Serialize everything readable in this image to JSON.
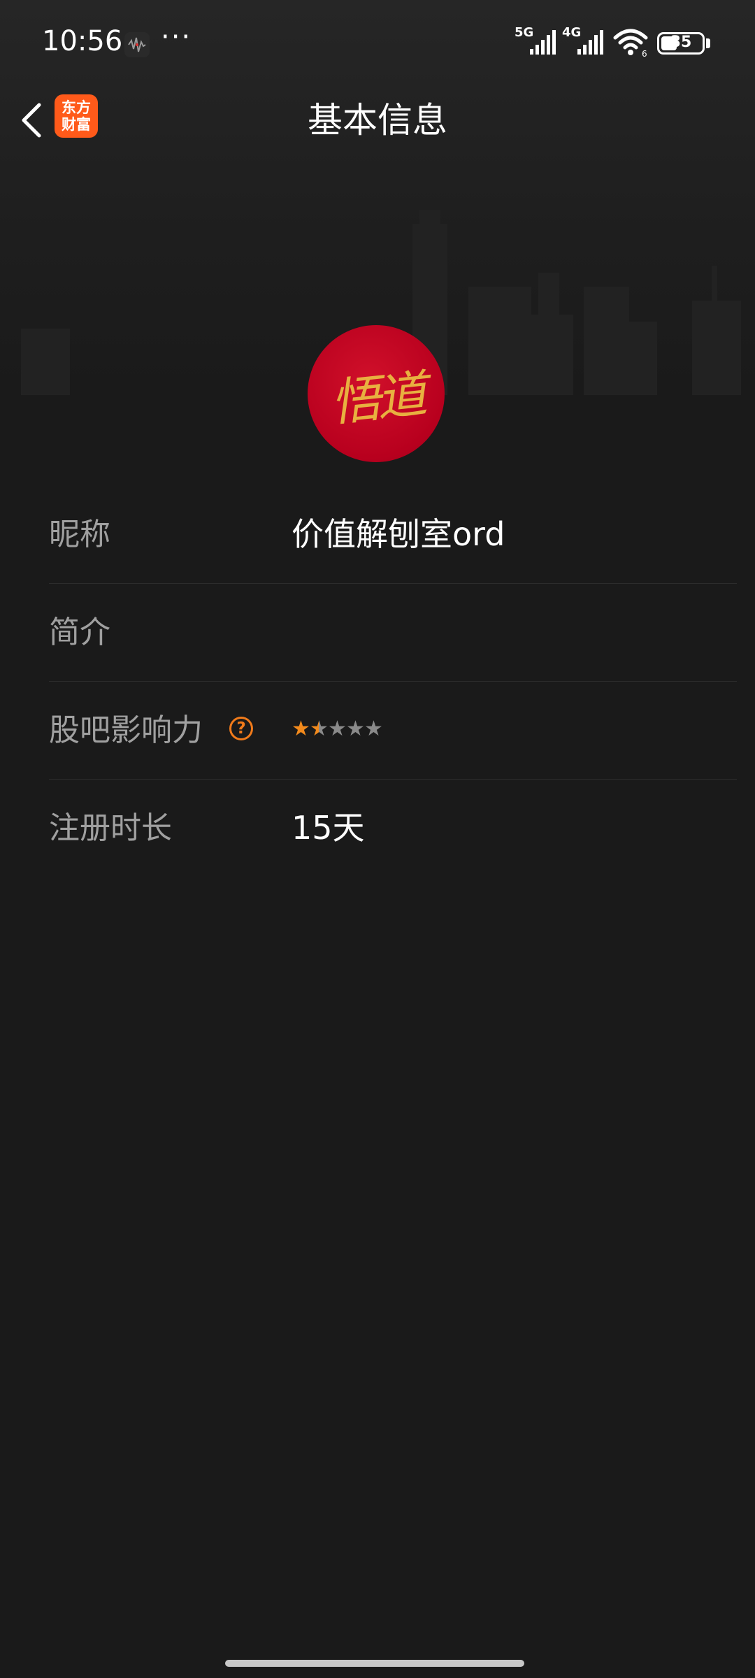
{
  "status_bar": {
    "time": "10:56",
    "network_1": "5G",
    "network_2": "4G",
    "wifi_sub": "6",
    "battery_level": "35",
    "more_indicator": "···"
  },
  "header": {
    "title": "基本信息",
    "app_logo_line1": "东方",
    "app_logo_line2": "财富"
  },
  "profile": {
    "avatar_text": "悟道"
  },
  "info": {
    "nickname_label": "昵称",
    "nickname_value": "价值解刨室ord",
    "intro_label": "简介",
    "intro_value": "",
    "influence_label": "股吧影响力",
    "influence_help_icon": "?",
    "influence_rating": 1.5,
    "influence_max": 5,
    "register_label": "注册时长",
    "register_value": "15天"
  },
  "colors": {
    "background": "#1a1a1a",
    "accent": "#f28a1c",
    "label_gray": "#a0a0a0",
    "avatar_red": "#c8001f"
  }
}
